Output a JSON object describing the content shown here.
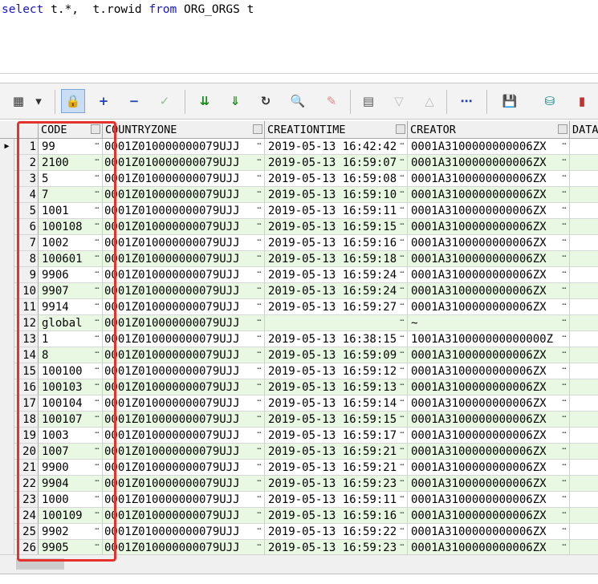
{
  "editor": {
    "sql_kw1": "select",
    "sql_part1": " t.*,  t.rowid ",
    "sql_kw2": "from",
    "sql_part2": " ORG_ORGS t"
  },
  "toolbar": {
    "icons": [
      "grid-view-icon",
      "dropdown-arrow-icon",
      "lock-icon",
      "add-record-icon",
      "delete-record-icon",
      "post-changes-icon",
      "fetch-next-icon",
      "fetch-all-icon",
      "refresh-icon",
      "find-icon",
      "clear-icon",
      "export-icon",
      "sort-desc-icon",
      "sort-asc-icon",
      "query-tree-icon",
      "save-icon",
      "database-icon",
      "chart-icon"
    ],
    "glyphs": [
      "▦",
      "▾",
      "🔒",
      "+",
      "−",
      "✓",
      "⇊",
      "⇓",
      "↻",
      "🔍",
      "✎",
      "▤",
      "▽",
      "△",
      "⋯",
      "💾",
      "⛁",
      "▮"
    ]
  },
  "grid": {
    "headers": [
      "CODE",
      "COUNTRYZONE",
      "CREATIONTIME",
      "CREATOR",
      "DATA"
    ],
    "rows": [
      {
        "num": "1",
        "code": "99",
        "zone": "0001Z010000000079UJJ",
        "time": "2019-05-13 16:42:42",
        "creator": "0001A3100000000006ZX"
      },
      {
        "num": "2",
        "code": "2100",
        "zone": "0001Z010000000079UJJ",
        "time": "2019-05-13 16:59:07",
        "creator": "0001A3100000000006ZX"
      },
      {
        "num": "3",
        "code": "5",
        "zone": "0001Z010000000079UJJ",
        "time": "2019-05-13 16:59:08",
        "creator": "0001A3100000000006ZX"
      },
      {
        "num": "4",
        "code": "7",
        "zone": "0001Z010000000079UJJ",
        "time": "2019-05-13 16:59:10",
        "creator": "0001A3100000000006ZX"
      },
      {
        "num": "5",
        "code": "1001",
        "zone": "0001Z010000000079UJJ",
        "time": "2019-05-13 16:59:11",
        "creator": "0001A3100000000006ZX"
      },
      {
        "num": "6",
        "code": "100108",
        "zone": "0001Z010000000079UJJ",
        "time": "2019-05-13 16:59:15",
        "creator": "0001A3100000000006ZX"
      },
      {
        "num": "7",
        "code": "1002",
        "zone": "0001Z010000000079UJJ",
        "time": "2019-05-13 16:59:16",
        "creator": "0001A3100000000006ZX"
      },
      {
        "num": "8",
        "code": "100601",
        "zone": "0001Z010000000079UJJ",
        "time": "2019-05-13 16:59:18",
        "creator": "0001A3100000000006ZX"
      },
      {
        "num": "9",
        "code": "9906",
        "zone": "0001Z010000000079UJJ",
        "time": "2019-05-13 16:59:24",
        "creator": "0001A3100000000006ZX"
      },
      {
        "num": "10",
        "code": "9907",
        "zone": "0001Z010000000079UJJ",
        "time": "2019-05-13 16:59:24",
        "creator": "0001A3100000000006ZX"
      },
      {
        "num": "11",
        "code": "9914",
        "zone": "0001Z010000000079UJJ",
        "time": "2019-05-13 16:59:27",
        "creator": "0001A3100000000006ZX"
      },
      {
        "num": "12",
        "code": "global",
        "zone": "0001Z010000000079UJJ",
        "time": "",
        "creator": "~"
      },
      {
        "num": "13",
        "code": "1",
        "zone": "0001Z010000000079UJJ",
        "time": "2019-05-13 16:38:15",
        "creator": "1001A310000000000000Z"
      },
      {
        "num": "14",
        "code": "8",
        "zone": "0001Z010000000079UJJ",
        "time": "2019-05-13 16:59:09",
        "creator": "0001A3100000000006ZX"
      },
      {
        "num": "15",
        "code": "100100",
        "zone": "0001Z010000000079UJJ",
        "time": "2019-05-13 16:59:12",
        "creator": "0001A3100000000006ZX"
      },
      {
        "num": "16",
        "code": "100103",
        "zone": "0001Z010000000079UJJ",
        "time": "2019-05-13 16:59:13",
        "creator": "0001A3100000000006ZX"
      },
      {
        "num": "17",
        "code": "100104",
        "zone": "0001Z010000000079UJJ",
        "time": "2019-05-13 16:59:14",
        "creator": "0001A3100000000006ZX"
      },
      {
        "num": "18",
        "code": "100107",
        "zone": "0001Z010000000079UJJ",
        "time": "2019-05-13 16:59:15",
        "creator": "0001A3100000000006ZX"
      },
      {
        "num": "19",
        "code": "1003",
        "zone": "0001Z010000000079UJJ",
        "time": "2019-05-13 16:59:17",
        "creator": "0001A3100000000006ZX"
      },
      {
        "num": "20",
        "code": "1007",
        "zone": "0001Z010000000079UJJ",
        "time": "2019-05-13 16:59:21",
        "creator": "0001A3100000000006ZX"
      },
      {
        "num": "21",
        "code": "9900",
        "zone": "0001Z010000000079UJJ",
        "time": "2019-05-13 16:59:21",
        "creator": "0001A3100000000006ZX"
      },
      {
        "num": "22",
        "code": "9904",
        "zone": "0001Z010000000079UJJ",
        "time": "2019-05-13 16:59:23",
        "creator": "0001A3100000000006ZX"
      },
      {
        "num": "23",
        "code": "1000",
        "zone": "0001Z010000000079UJJ",
        "time": "2019-05-13 16:59:11",
        "creator": "0001A3100000000006ZX"
      },
      {
        "num": "24",
        "code": "100109",
        "zone": "0001Z010000000079UJJ",
        "time": "2019-05-13 16:59:16",
        "creator": "0001A3100000000006ZX"
      },
      {
        "num": "25",
        "code": "9902",
        "zone": "0001Z010000000079UJJ",
        "time": "2019-05-13 16:59:22",
        "creator": "0001A3100000000006ZX"
      },
      {
        "num": "26",
        "code": "9905",
        "zone": "0001Z010000000079UJJ",
        "time": "2019-05-13 16:59:23",
        "creator": "0001A3100000000006ZX"
      }
    ]
  },
  "colors": {
    "highlight_box": "#e5322d",
    "alt_row": "#e8f8e2",
    "keyword": "#1414c8"
  }
}
